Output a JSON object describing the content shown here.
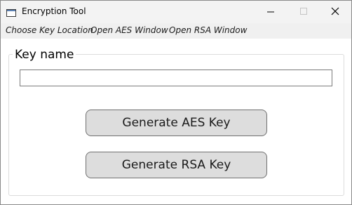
{
  "window": {
    "title": "Encryption Tool"
  },
  "menu": {
    "items": [
      {
        "label": "Choose Key Location"
      },
      {
        "label": "Open AES Window"
      },
      {
        "label": "Open RSA Window"
      }
    ]
  },
  "key_group": {
    "label": "Key name",
    "input_value": "",
    "input_placeholder": ""
  },
  "buttons": {
    "generate_aes_label": "Generate AES Key",
    "generate_rsa_label": "Generate RSA Key"
  },
  "icons": {
    "app": "window-app-icon",
    "minimize": "minimize-icon",
    "maximize": "maximize-icon",
    "close": "close-icon"
  },
  "colors": {
    "titlebar_bg": "#f3f3f3",
    "menubar_bg": "#f0f0f0",
    "button_bg": "#dddddd",
    "button_border": "#707070"
  }
}
